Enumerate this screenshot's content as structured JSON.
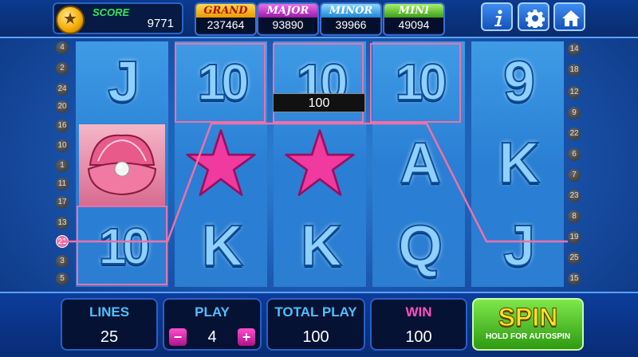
{
  "header": {
    "score_label": "SCORE",
    "score_value": "9771",
    "coin_glyph": "★",
    "jackpots": [
      {
        "name": "GRAND",
        "value": "237464"
      },
      {
        "name": "MAJOR",
        "value": "93890"
      },
      {
        "name": "MINOR",
        "value": "39966"
      },
      {
        "name": "MINI",
        "value": "49094"
      }
    ],
    "buttons": [
      {
        "icon": "info-icon"
      },
      {
        "icon": "gear-icon"
      },
      {
        "icon": "home-icon"
      }
    ]
  },
  "reels": {
    "columns": [
      [
        "J",
        "pearl",
        "10"
      ],
      [
        "10",
        "starfish",
        "K"
      ],
      [
        "10",
        "starfish",
        "K"
      ],
      [
        "10",
        "A",
        "Q"
      ],
      [
        "9",
        "K",
        "J"
      ]
    ],
    "win_value": "100"
  },
  "line_numbers": {
    "left": [
      "4",
      "2",
      "24",
      "20",
      "16",
      "10",
      "1",
      "11",
      "17",
      "13",
      "21",
      "3",
      "5"
    ],
    "right": [
      "14",
      "18",
      "12",
      "9",
      "22",
      "6",
      "7",
      "23",
      "8",
      "19",
      "25",
      "15"
    ],
    "active": "21"
  },
  "footer": {
    "lines_label": "LINES",
    "lines_value": "25",
    "play_label": "PLAY",
    "play_value": "4",
    "minus_label": "−",
    "plus_label": "+",
    "total_label": "TOTAL PLAY",
    "total_value": "100",
    "win_label": "WIN",
    "win_value": "100",
    "spin_label": "SPIN",
    "spin_sub": "HOLD FOR AUTOSPIN"
  },
  "colors": {
    "win_line": "#f070a8",
    "spin_text": "#ffe024",
    "score_label": "#33e85a"
  }
}
